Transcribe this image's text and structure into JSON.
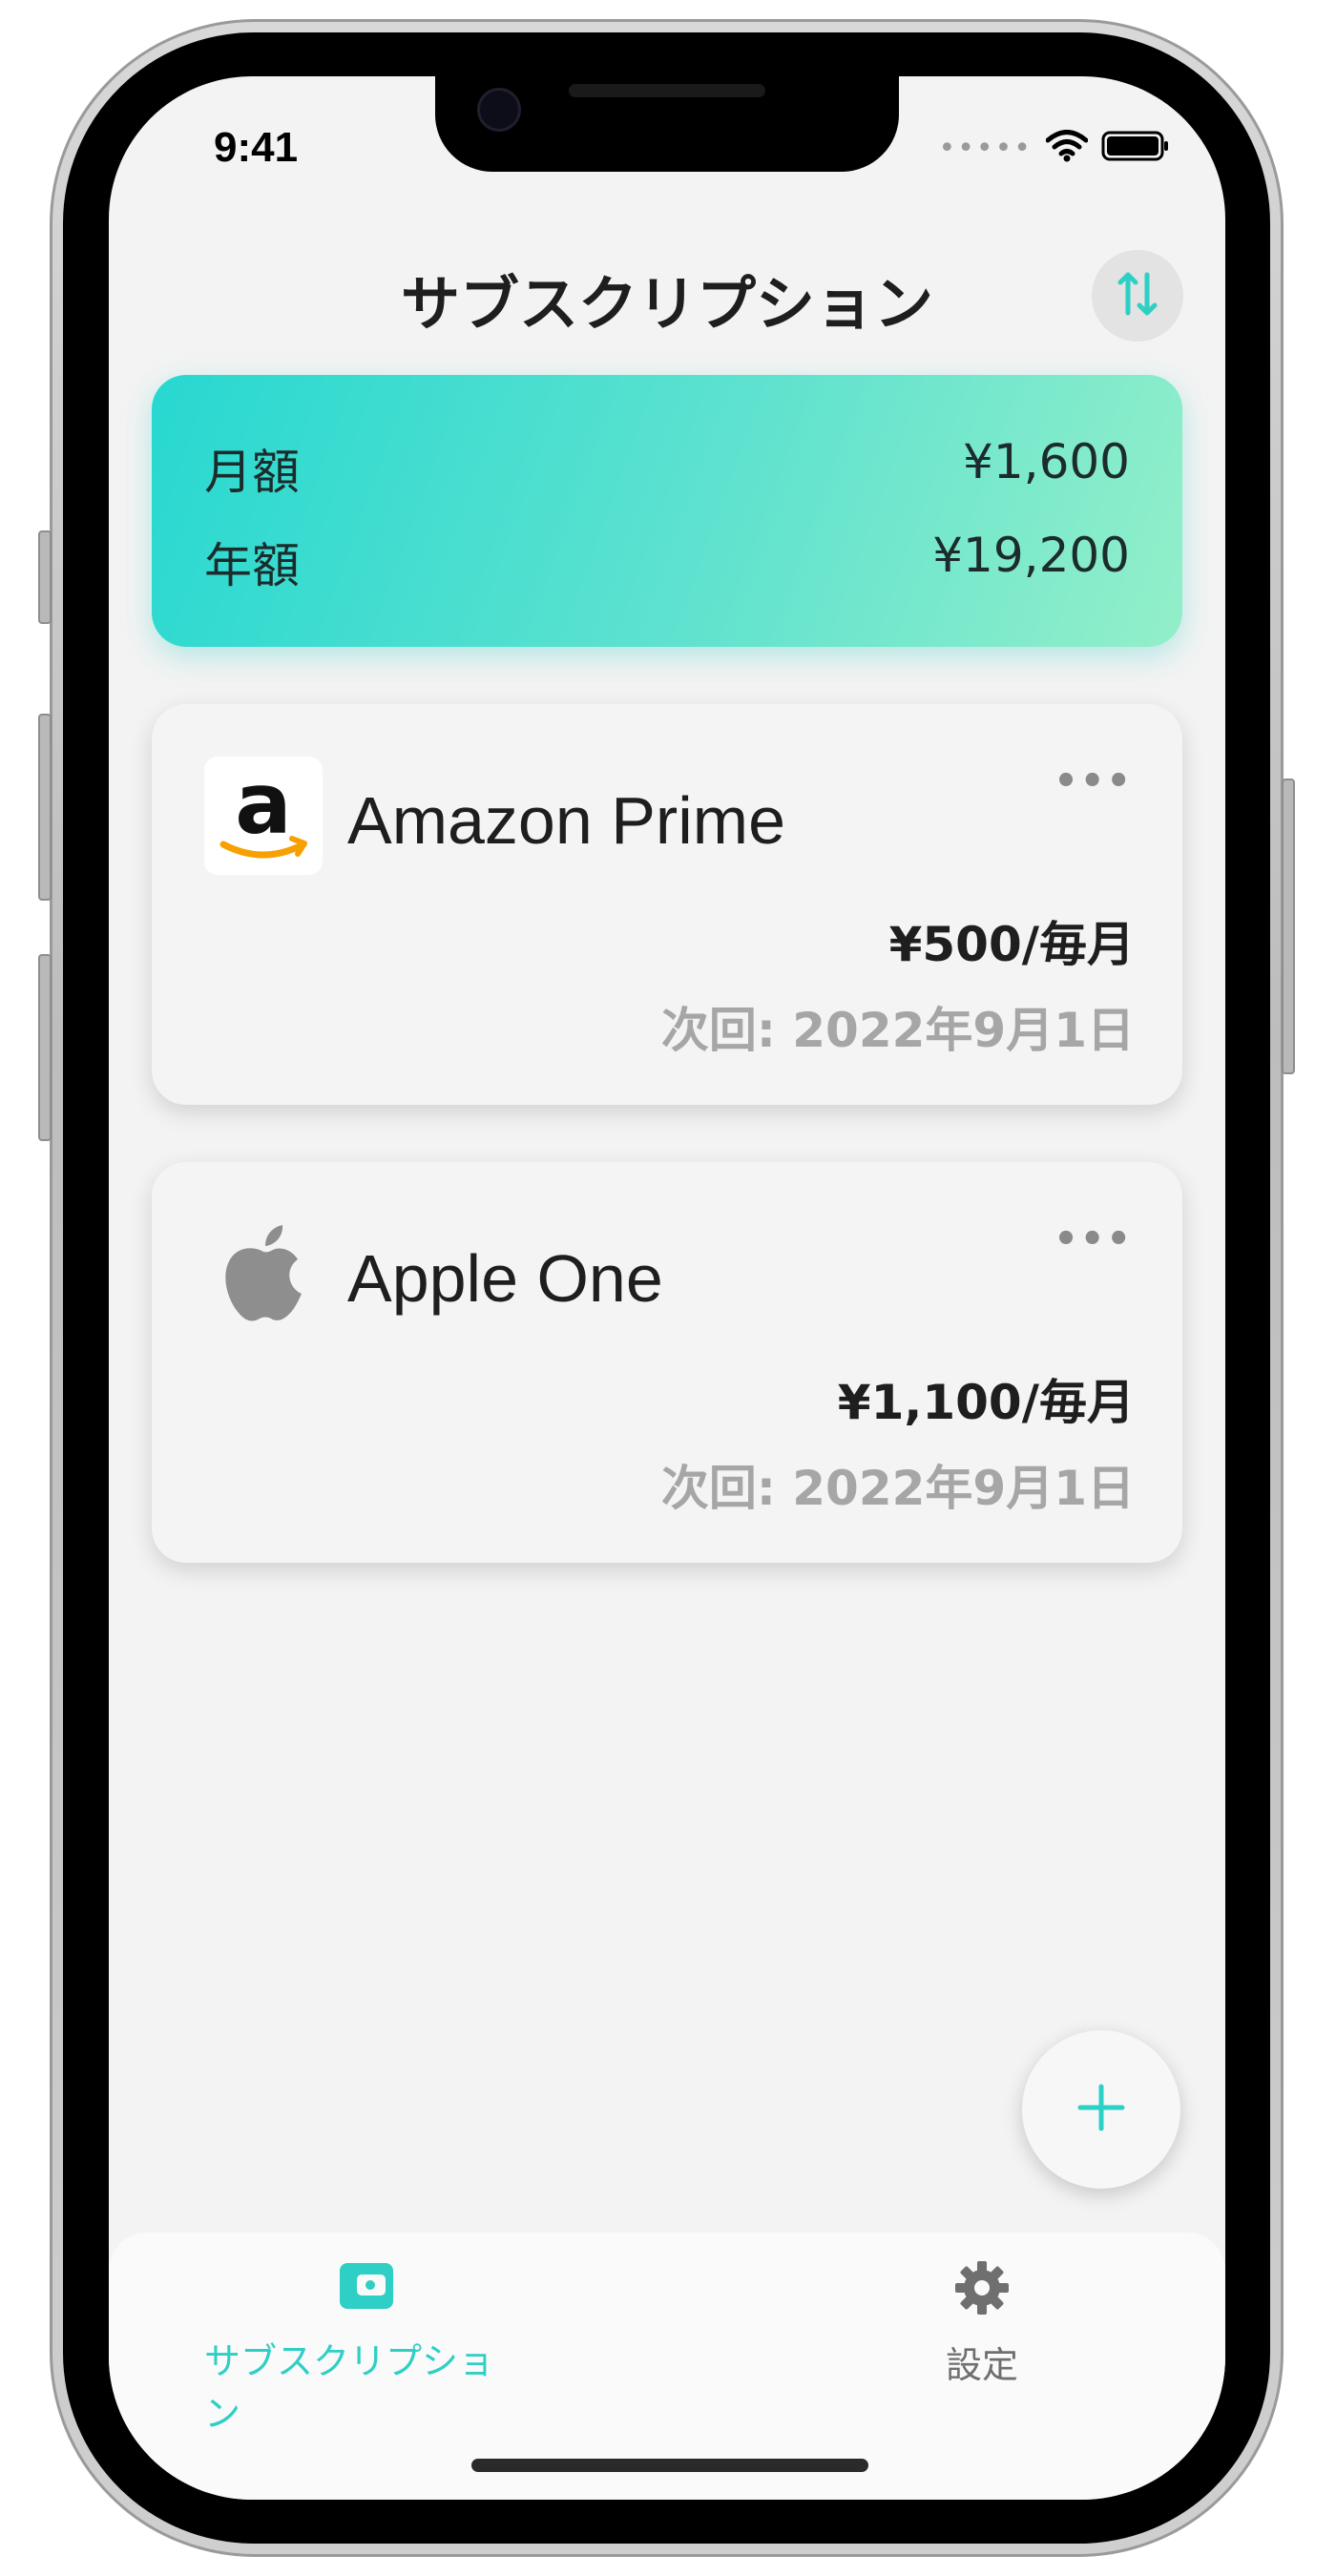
{
  "status_bar": {
    "time": "9:41",
    "dots": "•••••"
  },
  "header": {
    "title": "サブスクリプション"
  },
  "summary": {
    "monthly_label": "月額",
    "monthly_value": "¥1,600",
    "yearly_label": "年額",
    "yearly_value": "¥19,200"
  },
  "subscriptions": [
    {
      "name": "Amazon Prime",
      "price": "¥500/毎月",
      "next": "次回: 2022年9月1日",
      "icon": "amazon-logo",
      "menu": "•••"
    },
    {
      "name": "Apple One",
      "price": "¥1,100/毎月",
      "next": "次回: 2022年9月1日",
      "icon": "apple-logo",
      "menu": "•••"
    }
  ],
  "fab": {
    "label": "+"
  },
  "tabbar": {
    "items": [
      {
        "label": "サブスクリプション",
        "icon": "wallet-icon",
        "active": true
      },
      {
        "label": "設定",
        "icon": "gear-icon",
        "active": false
      }
    ]
  },
  "colors": {
    "accent": "#2ecfc4",
    "summary_gradient_start": "#27d8d0",
    "summary_gradient_end": "#93efc9",
    "inactive_tab": "#6f6f6f"
  }
}
